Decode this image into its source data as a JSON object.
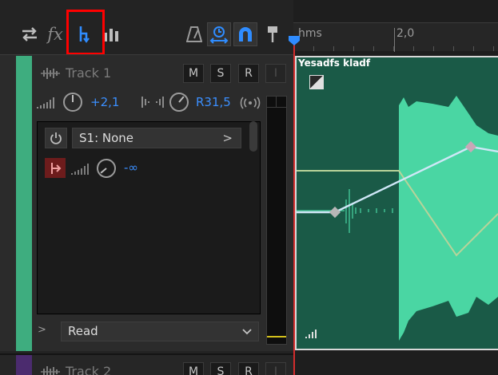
{
  "toolbar": {
    "fx_label": "fx",
    "tooltips": []
  },
  "track1": {
    "name": "Track 1",
    "buttons": {
      "mute": "M",
      "solo": "S",
      "record": "R",
      "input": "I"
    },
    "volume_value": "+2,1",
    "pan_value": "R31,5",
    "send_label": "S1: None",
    "send_arrow": ">",
    "send_volume_value": "-∞",
    "automation_mode": "Read",
    "expand_arrow": ">"
  },
  "track2": {
    "name": "Track 2",
    "buttons": {
      "mute": "M",
      "solo": "S",
      "record": "R",
      "input": "I"
    }
  },
  "timeline": {
    "ruler_unit": "hms",
    "ruler_tick": "2,0"
  },
  "clip": {
    "title": "Yesadfs kladf"
  },
  "colors": {
    "track1_color": "#3ead7f",
    "track2_color": "#4b2b6e",
    "clip_background": "#1a5a47",
    "waveform": "#4ad6a3",
    "accent_blue": "#3b8fff",
    "playhead": "#d32d2d",
    "highlight": "#ff0000"
  }
}
